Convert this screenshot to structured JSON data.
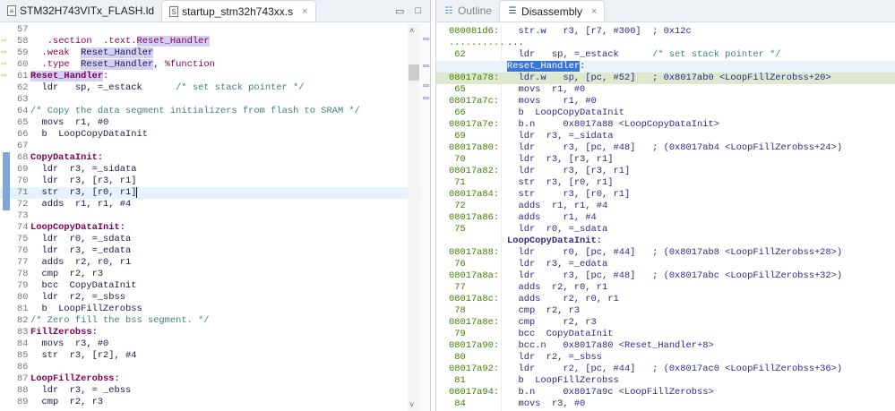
{
  "left_pane": {
    "tabs": [
      {
        "label": "STM32H743VITx_FLASH.ld",
        "icon": "file-icon",
        "active": false
      },
      {
        "label": "startup_stm32h743xx.s",
        "icon": "asm-file-icon",
        "active": true,
        "close": "×"
      }
    ],
    "lines": [
      {
        "n": "57",
        "seg": []
      },
      {
        "n": "58",
        "m": true,
        "seg": [
          [
            "   ",
            "pl"
          ],
          [
            ".section",
            "kw"
          ],
          [
            "  ",
            "pl"
          ],
          [
            ".text.",
            "kw"
          ],
          [
            "Reset_Handler",
            "kw hl"
          ]
        ]
      },
      {
        "n": "59",
        "m": true,
        "seg": [
          [
            "  ",
            "pl"
          ],
          [
            ".weak",
            "kw"
          ],
          [
            "  ",
            "pl"
          ],
          [
            "Reset_Handler",
            "pl hl"
          ]
        ]
      },
      {
        "n": "60",
        "m": true,
        "seg": [
          [
            "  ",
            "pl"
          ],
          [
            ".type",
            "kw"
          ],
          [
            "  ",
            "pl"
          ],
          [
            "Reset_Handler",
            "pl hl"
          ],
          [
            ", ",
            "pl"
          ],
          [
            "%function",
            "kw"
          ]
        ]
      },
      {
        "n": "61",
        "m": true,
        "seg": [
          [
            "Reset_Handler",
            "lbl hl"
          ],
          [
            ":",
            "kw"
          ]
        ]
      },
      {
        "n": "62",
        "seg": [
          [
            "  ldr   sp, =_estack      ",
            "pl"
          ],
          [
            "/* set stack pointer */",
            "cm"
          ]
        ]
      },
      {
        "n": "63",
        "seg": []
      },
      {
        "n": "64",
        "seg": [
          [
            "/* Copy the data segment initializers from flash to SRAM */",
            "cm"
          ]
        ]
      },
      {
        "n": "65",
        "seg": [
          [
            "  movs  r1, #0",
            "pl"
          ]
        ]
      },
      {
        "n": "66",
        "seg": [
          [
            "  b  LoopCopyDataInit",
            "pl"
          ]
        ]
      },
      {
        "n": "67",
        "seg": []
      },
      {
        "n": "68",
        "c": true,
        "seg": [
          [
            "CopyDataInit:",
            "lbl"
          ]
        ]
      },
      {
        "n": "69",
        "c": true,
        "seg": [
          [
            "  ldr  r3, =_sidata",
            "pl"
          ]
        ]
      },
      {
        "n": "70",
        "c": true,
        "seg": [
          [
            "  ldr  r3, [r3, r1]",
            "pl"
          ]
        ]
      },
      {
        "n": "71",
        "c": true,
        "cur": true,
        "seg": [
          [
            "  str  r3, [r0, r1]",
            "pl caret"
          ]
        ]
      },
      {
        "n": "72",
        "c": true,
        "seg": [
          [
            "  adds  r1, r1, #4",
            "pl"
          ]
        ]
      },
      {
        "n": "73",
        "seg": []
      },
      {
        "n": "74",
        "seg": [
          [
            "LoopCopyDataInit:",
            "lbl"
          ]
        ]
      },
      {
        "n": "75",
        "seg": [
          [
            "  ldr  r0, =_sdata",
            "pl"
          ]
        ]
      },
      {
        "n": "76",
        "seg": [
          [
            "  ldr  r3, =_edata",
            "pl"
          ]
        ]
      },
      {
        "n": "77",
        "seg": [
          [
            "  adds  r2, r0, r1",
            "pl"
          ]
        ]
      },
      {
        "n": "78",
        "seg": [
          [
            "  cmp  r2, r3",
            "pl"
          ]
        ]
      },
      {
        "n": "79",
        "seg": [
          [
            "  bcc  CopyDataInit",
            "pl"
          ]
        ]
      },
      {
        "n": "80",
        "seg": [
          [
            "  ldr  r2, =_sbss",
            "pl"
          ]
        ]
      },
      {
        "n": "81",
        "seg": [
          [
            "  b  LoopFillZerobss",
            "pl"
          ]
        ]
      },
      {
        "n": "82",
        "seg": [
          [
            "/* Zero fill the bss segment. */",
            "cm"
          ]
        ]
      },
      {
        "n": "83",
        "seg": [
          [
            "FillZerobss:",
            "lbl"
          ]
        ]
      },
      {
        "n": "84",
        "seg": [
          [
            "  movs  r3, #0",
            "pl"
          ]
        ]
      },
      {
        "n": "85",
        "seg": [
          [
            "  str  r3, [r2], #4",
            "pl"
          ]
        ]
      },
      {
        "n": "86",
        "seg": []
      },
      {
        "n": "87",
        "seg": [
          [
            "LoopFillZerobss:",
            "lbl"
          ]
        ]
      },
      {
        "n": "88",
        "seg": [
          [
            "  ldr  r3, = _ebss",
            "pl"
          ]
        ]
      },
      {
        "n": "89",
        "seg": [
          [
            "  cmp  r2, r3",
            "pl"
          ]
        ]
      }
    ]
  },
  "right_pane": {
    "tabs": [
      {
        "label": "Outline",
        "icon": "outline-icon",
        "active": false
      },
      {
        "label": "Disassembly",
        "icon": "disassembly-icon",
        "active": true,
        "close": "×"
      }
    ],
    "rows": [
      {
        "a": "080081d6:",
        "seg": [
          [
            "  str.w   r3, [r7, #300]  ; 0x12c",
            "dis"
          ]
        ]
      },
      {
        "a": "..........",
        "seg": [
          [
            "...",
            "dis"
          ]
        ]
      },
      {
        "a": " 62",
        "seg": [
          [
            "  ldr   sp, =_estack      ",
            "dis"
          ],
          [
            "/* set stack pointer */",
            "cm"
          ]
        ]
      },
      {
        "a": "",
        "row": "lblrow",
        "seg": [
          [
            "Reset_Handler",
            "sel"
          ],
          [
            ":",
            "dis"
          ]
        ]
      },
      {
        "a": "08017a78:",
        "row": "pc",
        "seg": [
          [
            "  ldr.w   sp, [pc, #52]   ; 0x8017ab0 <LoopFillZerobss+20>",
            "dis"
          ]
        ]
      },
      {
        "a": " 65",
        "seg": [
          [
            "  movs  r1, #0",
            "dis"
          ]
        ]
      },
      {
        "a": "08017a7c:",
        "seg": [
          [
            "  movs    r1, #0",
            "dis"
          ]
        ]
      },
      {
        "a": " 66",
        "seg": [
          [
            "  b  LoopCopyDataInit",
            "dis"
          ]
        ]
      },
      {
        "a": "08017a7e:",
        "seg": [
          [
            "  b.n     0x8017a88 <LoopCopyDataInit>",
            "dis"
          ]
        ]
      },
      {
        "a": " 69",
        "seg": [
          [
            "  ldr  r3, =_sidata",
            "dis"
          ]
        ]
      },
      {
        "a": "08017a80:",
        "seg": [
          [
            "  ldr     r3, [pc, #48]   ; (0x8017ab4 <LoopFillZerobss+24>)",
            "dis"
          ]
        ]
      },
      {
        "a": " 70",
        "seg": [
          [
            "  ldr  r3, [r3, r1]",
            "dis"
          ]
        ]
      },
      {
        "a": "08017a82:",
        "seg": [
          [
            "  ldr     r3, [r3, r1]",
            "dis"
          ]
        ]
      },
      {
        "a": " 71",
        "seg": [
          [
            "  str  r3, [r0, r1]",
            "dis"
          ]
        ]
      },
      {
        "a": "08017a84:",
        "seg": [
          [
            "  str     r3, [r0, r1]",
            "dis"
          ]
        ]
      },
      {
        "a": " 72",
        "seg": [
          [
            "  adds  r1, r1, #4",
            "dis"
          ]
        ]
      },
      {
        "a": "08017a86:",
        "seg": [
          [
            "  adds    r1, #4",
            "dis"
          ]
        ]
      },
      {
        "a": " 75",
        "seg": [
          [
            "  ldr  r0, =_sdata",
            "dis"
          ]
        ]
      },
      {
        "a": "",
        "seg": [
          [
            "LoopCopyDataInit:",
            "lbl dis"
          ]
        ]
      },
      {
        "a": "08017a88:",
        "seg": [
          [
            "  ldr     r0, [pc, #44]   ; (0x8017ab8 <LoopFillZerobss+28>)",
            "dis"
          ]
        ]
      },
      {
        "a": " 76",
        "seg": [
          [
            "  ldr  r3, =_edata",
            "dis"
          ]
        ]
      },
      {
        "a": "08017a8a:",
        "seg": [
          [
            "  ldr     r3, [pc, #48]   ; (0x8017abc <LoopFillZerobss+32>)",
            "dis"
          ]
        ]
      },
      {
        "a": " 77",
        "seg": [
          [
            "  adds  r2, r0, r1",
            "dis"
          ]
        ]
      },
      {
        "a": "08017a8c:",
        "seg": [
          [
            "  adds    r2, r0, r1",
            "dis"
          ]
        ]
      },
      {
        "a": " 78",
        "seg": [
          [
            "  cmp  r2, r3",
            "dis"
          ]
        ]
      },
      {
        "a": "08017a8e:",
        "seg": [
          [
            "  cmp     r2, r3",
            "dis"
          ]
        ]
      },
      {
        "a": " 79",
        "seg": [
          [
            "  bcc  CopyDataInit",
            "dis"
          ]
        ]
      },
      {
        "a": "08017a90:",
        "seg": [
          [
            "  bcc.n   0x8017a80 <Reset_Handler+8>",
            "dis"
          ]
        ]
      },
      {
        "a": " 80",
        "seg": [
          [
            "  ldr  r2, =_sbss",
            "dis"
          ]
        ]
      },
      {
        "a": "08017a92:",
        "seg": [
          [
            "  ldr     r2, [pc, #44]   ; (0x8017ac0 <LoopFillZerobss+36>)",
            "dis"
          ]
        ]
      },
      {
        "a": " 81",
        "seg": [
          [
            "  b  LoopFillZerobss",
            "dis"
          ]
        ]
      },
      {
        "a": "08017a94:",
        "seg": [
          [
            "  b.n     0x8017a9c <LoopFillZerobss>",
            "dis"
          ]
        ]
      },
      {
        "a": " 84",
        "seg": [
          [
            "  movs  r3, #0",
            "dis"
          ]
        ]
      }
    ]
  },
  "icons": {
    "marker": "⇨",
    "minimize": "▭",
    "maximize": "□",
    "scroll_up": "˄",
    "scroll_down": "˅"
  }
}
